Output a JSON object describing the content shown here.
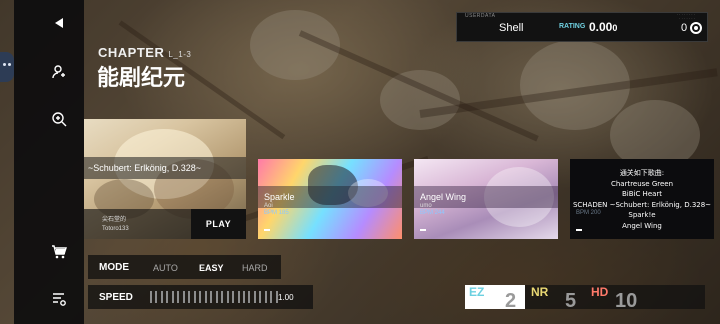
{
  "chapter": {
    "label": "CHAPTER",
    "code": "L_1-3",
    "title": "能剧纪元"
  },
  "user": {
    "section_label": "USERDATA",
    "player_name": "Shell",
    "rating_label": "RATING",
    "rating_value": "0.00",
    "rating_suffix": "0",
    "score": "0"
  },
  "songs": [
    {
      "title": "~Schubert: Erlkönig, D.328~",
      "artist": "尖石堂的",
      "illustrator": "Totoro133",
      "action_label": "PLAY"
    },
    {
      "title": "Sparkle",
      "artist": "Aoi",
      "bpm": "BPM 185"
    },
    {
      "title": "Angel Wing",
      "artist": "umo",
      "bpm": "BPM 244"
    },
    {
      "title": "通关如下歌曲:",
      "list": [
        "Chartreuse Green",
        "BiBiC Heart",
        "SCHADEN ~Schubert: Erlkönig, D.328~",
        "Spark!e",
        "Angel Wing"
      ],
      "bpm": "BPM 200"
    }
  ],
  "mode": {
    "label": "MODE",
    "options": [
      "AUTO",
      "EASY",
      "HARD"
    ],
    "selected": "EASY"
  },
  "speed": {
    "label": "SPEED",
    "value": "1.00"
  },
  "difficulty": [
    {
      "tag": "EZ",
      "level": "2",
      "color": "#6cd0e0"
    },
    {
      "tag": "NR",
      "level": "5",
      "color": "#e9d873"
    },
    {
      "tag": "HD",
      "level": "10",
      "color": "#ff7a6a"
    }
  ],
  "icons": {
    "back": "back-arrow-icon",
    "profile": "user-settings-icon",
    "search": "search-icon",
    "shop": "cart-icon",
    "list": "list-settings-icon"
  }
}
